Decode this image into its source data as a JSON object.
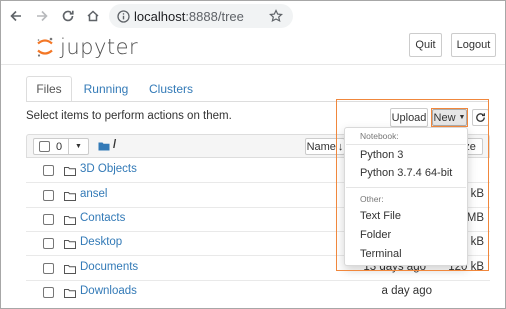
{
  "browser": {
    "url_host": "localhost",
    "url_port_path": ":8888/tree"
  },
  "header": {
    "logo_text": "jupyter",
    "quit_label": "Quit",
    "logout_label": "Logout"
  },
  "tabs": [
    {
      "label": "Files"
    },
    {
      "label": "Running"
    },
    {
      "label": "Clusters"
    }
  ],
  "toolbar": {
    "instructions": "Select items to perform actions on them.",
    "upload_label": "Upload",
    "new_label": "New",
    "selected_count": "0",
    "breadcrumb": "/",
    "name_sort_label": "Name",
    "size_sort_label": "ze"
  },
  "files": [
    {
      "name": "3D Objects",
      "time": "",
      "size": ""
    },
    {
      "name": "ansel",
      "time": "",
      "size": "kB"
    },
    {
      "name": "Contacts",
      "time": "",
      "size": "MB"
    },
    {
      "name": "Desktop",
      "time": "",
      "size": "kB"
    },
    {
      "name": "Documents",
      "time": "13 days ago",
      "size": "120 kB"
    },
    {
      "name": "Downloads",
      "time": "a day ago",
      "size": ""
    }
  ],
  "new_menu": {
    "notebook_header": "Notebook:",
    "python3": "Python 3",
    "python374": "Python 3.7.4 64-bit",
    "other_header": "Other:",
    "text_file": "Text File",
    "folder": "Folder",
    "terminal": "Terminal"
  },
  "colors": {
    "link": "#337ab7",
    "accent_highlight": "#f0873c",
    "logo_orange": "#f37726"
  }
}
